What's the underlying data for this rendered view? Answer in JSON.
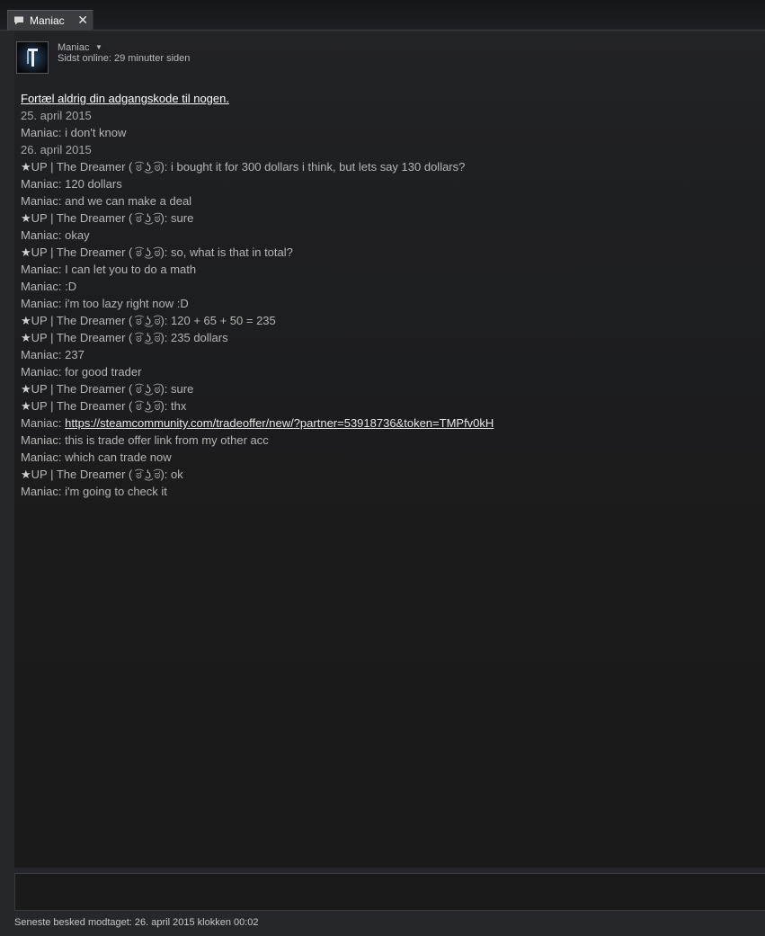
{
  "tab": {
    "title": "Maniac",
    "close_glyph": "✕",
    "icon": "chat-bubble-icon"
  },
  "header": {
    "avatar_icon": "avatar-icon",
    "name": "Maniac",
    "dropdown_glyph": "▼",
    "status": "Sidst online: 29 minutter siden"
  },
  "log": {
    "warning": "Fortæl aldrig din adgangskode til nogen.",
    "date1": "25. april 2015",
    "m1": {
      "who": "Maniac: ",
      "text": "i don't know"
    },
    "date2": "26. april 2015",
    "m2": {
      "star": "★",
      "who": "UP | The Dreamer ( ͡ಠ ͜ʖ ͡ಠ): ",
      "text": "i bought it for 300 dollars i think, but lets say 130 dollars?"
    },
    "m3": {
      "who": "Maniac: ",
      "text": "120 dollars"
    },
    "m4": {
      "who": "Maniac: ",
      "text": "and we can make a deal"
    },
    "m5": {
      "star": "★",
      "who": "UP | The Dreamer ( ͡ಠ ͜ʖ ͡ಠ): ",
      "text": "sure"
    },
    "m6": {
      "who": "Maniac: ",
      "text": "okay"
    },
    "m7": {
      "star": "★",
      "who": "UP | The Dreamer ( ͡ಠ ͜ʖ ͡ಠ): ",
      "text": "so, what is that in total?"
    },
    "m8": {
      "who": "Maniac: ",
      "text": "I can let you to do a math"
    },
    "m9": {
      "who": "Maniac: ",
      "text": ":D"
    },
    "m10": {
      "who": "Maniac: ",
      "text": "i'm too lazy right now :D"
    },
    "m11": {
      "star": "★",
      "who": "UP | The Dreamer ( ͡ಠ ͜ʖ ͡ಠ): ",
      "text": "120 + 65 + 50 = 235"
    },
    "m12": {
      "star": "★",
      "who": "UP | The Dreamer ( ͡ಠ ͜ʖ ͡ಠ): ",
      "text": "235 dollars"
    },
    "m13": {
      "who": "Maniac: ",
      "text": "237"
    },
    "m14": {
      "who": "Maniac: ",
      "text": "for good trader"
    },
    "m15": {
      "star": "★",
      "who": "UP | The Dreamer ( ͡ಠ ͜ʖ ͡ಠ): ",
      "text": "sure"
    },
    "m16": {
      "star": "★",
      "who": "UP | The Dreamer ( ͡ಠ ͜ʖ ͡ಠ): ",
      "text": "thx"
    },
    "m17": {
      "who": "Maniac: ",
      "link": "https://steamcommunity.com/tradeoffer/new/?partner=53918736&token=TMPfv0kH"
    },
    "m18": {
      "who": "Maniac: ",
      "text": "this is trade offer link from my other acc"
    },
    "m19": {
      "who": "Maniac: ",
      "text": "which can trade now"
    },
    "m20": {
      "star": "★",
      "who": "UP | The Dreamer ( ͡ಠ ͜ʖ ͡ಠ): ",
      "text": "ok"
    },
    "m21": {
      "who": "Maniac: ",
      "text": "i'm going to check it"
    }
  },
  "input": {
    "value": ""
  },
  "footer": {
    "last_message": "Seneste besked modtaget: 26. april 2015 klokken 00:02"
  },
  "colors": {
    "background": "#26272b",
    "text": "#b5b5b5",
    "link": "#e6e6e6"
  }
}
